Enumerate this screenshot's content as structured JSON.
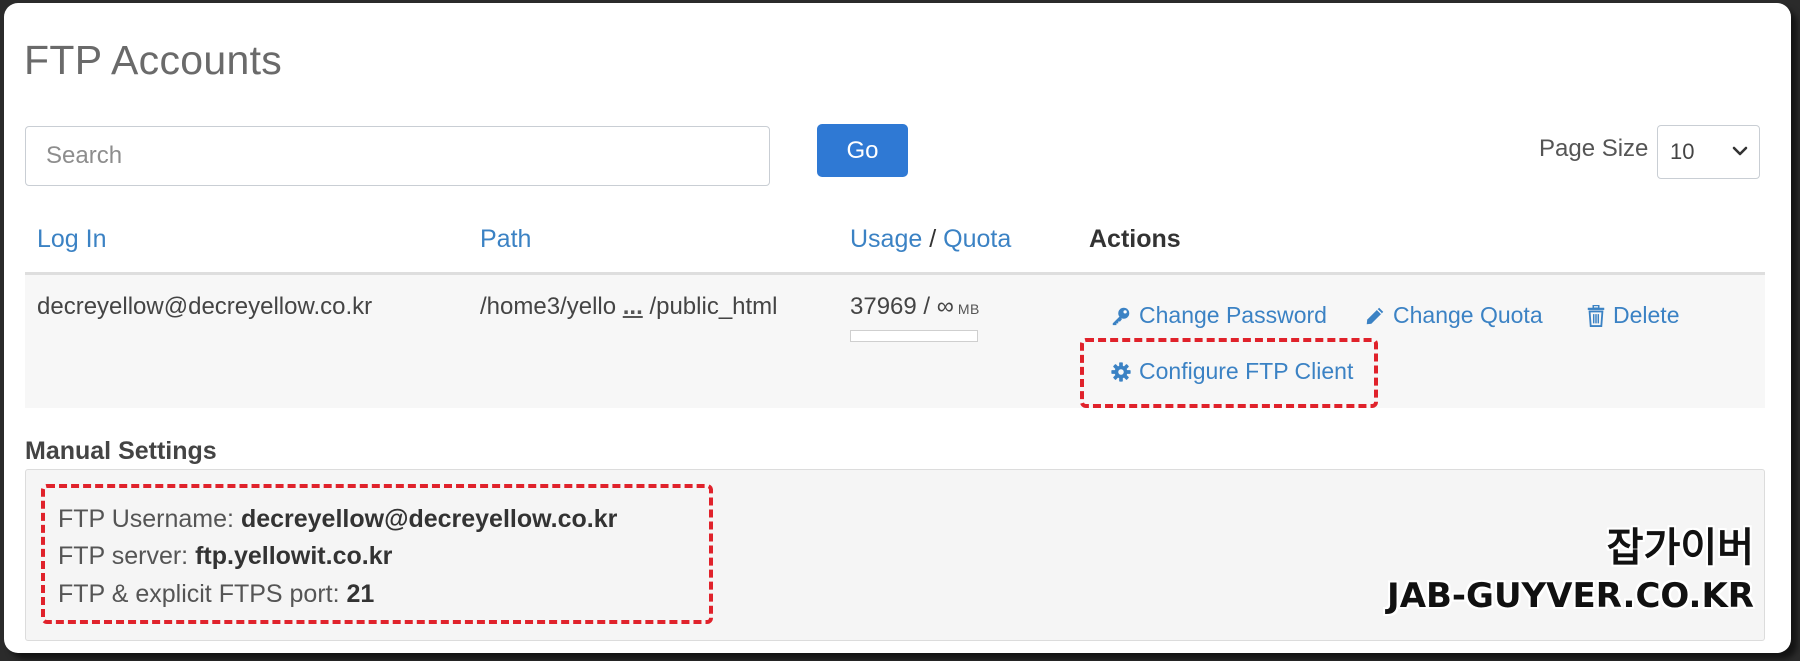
{
  "page": {
    "title": "FTP Accounts"
  },
  "search": {
    "placeholder": "Search",
    "value": "",
    "go_label": "Go"
  },
  "page_size": {
    "label": "Page Size",
    "selected": "10"
  },
  "table": {
    "headers": {
      "login": "Log In",
      "path": "Path",
      "usage": "Usage",
      "usage_separator": "/",
      "quota": "Quota",
      "actions": "Actions"
    },
    "rows": [
      {
        "login": "decreyellow@decreyellow.co.kr",
        "path_start": "/home3/yello",
        "path_ellipsis": "...",
        "path_end": "/public_html",
        "usage_value": "37969 / ∞",
        "usage_unit": "MB",
        "usage_fraction": 0,
        "actions": {
          "change_password": "Change Password",
          "change_quota": "Change Quota",
          "delete": "Delete",
          "configure_client": "Configure FTP Client"
        }
      }
    ]
  },
  "manual_settings": {
    "title": "Manual Settings",
    "username_label": "FTP Username:",
    "username_value": "decreyellow@decreyellow.co.kr",
    "server_label": "FTP server:",
    "server_value": "ftp.yellowit.co.kr",
    "port_label": "FTP & explicit FTPS port:",
    "port_value": "21"
  },
  "watermark": {
    "korean": "잡가이버",
    "site": "JAB-GUYVER.CO.KR"
  },
  "colors": {
    "link": "#3b82c4",
    "primary_button": "#2f79d4",
    "highlight": "#e0222b"
  },
  "icons": {
    "change_password": "key-icon",
    "change_quota": "pencil-icon",
    "delete": "trash-icon",
    "configure_client": "gear-icon",
    "page_size_dropdown": "chevron-down-icon"
  }
}
